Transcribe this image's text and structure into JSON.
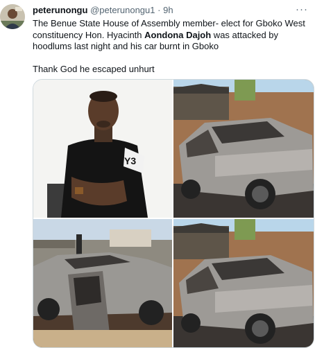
{
  "tweet": {
    "display_name": "peterunongu",
    "handle": "@peterunongu1",
    "separator": "·",
    "time": "9h",
    "more_label": "···",
    "text_part1": "The Benue State House of Assembly member- elect for Gboko West constituency Hon. Hyacinth ",
    "text_bold": "Aondona Dajoh",
    "text_part2": " was attacked by hoodlums last night and his car burnt in Gboko",
    "text_line2": "Thank God he escaped unhurt",
    "images": [
      {
        "icon": "portrait-man-photo"
      },
      {
        "icon": "burnt-car-photo"
      },
      {
        "icon": "burnt-car-open-door-photo"
      },
      {
        "icon": "burnt-car-photo"
      }
    ]
  }
}
